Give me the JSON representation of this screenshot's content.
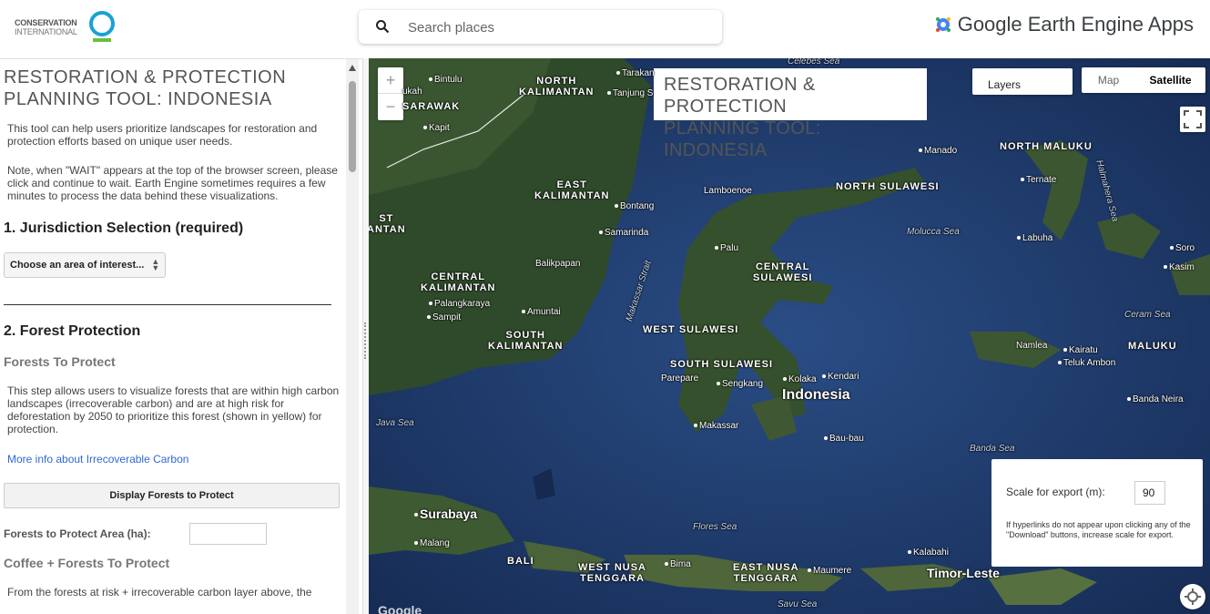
{
  "header": {
    "org_logo_line1": "CONSERVATION",
    "org_logo_line2": "INTERNATIONAL",
    "search_placeholder": "Search places",
    "brand_title": "Google Earth Engine Apps"
  },
  "panel": {
    "title_line1": "RESTORATION & PROTECTION",
    "title_line2": "PLANNING TOOL: INDONESIA",
    "intro": "This tool can help users prioritize landscapes for restoration and protection efforts based on unique user needs.",
    "note": "Note, when \"WAIT\" appears at the top of the browser screen, please click and continue to wait. Earth Engine sometimes requires a few minutes to process the data behind these visualizations.",
    "section1_heading": "1. Jurisdiction Selection (required)",
    "jurisdiction_select": "Choose an area of interest...",
    "section2_heading": "2. Forest Protection",
    "forests_heading": "Forests To Protect",
    "forests_desc": "This step allows users to visualize forests that are within high carbon landscapes (irrecoverable carbon) and are at high risk for deforestation by 2050 to prioritize this forest (shown in yellow) for protection.",
    "more_info_link": "More info about Irrecoverable Carbon",
    "display_button": "Display Forests to Protect",
    "area_label": "Forests to Protect Area (ha):",
    "coffee_heading": "Coffee + Forests To Protect",
    "coffee_desc": "From the forests at risk + irrecoverable carbon layer above, the"
  },
  "map": {
    "zoom_in": "+",
    "zoom_out": "−",
    "title_line1": "RESTORATION & PROTECTION",
    "title_line2": "PLANNING TOOL: INDONESIA",
    "layers_label": "Layers",
    "maptype_map": "Map",
    "maptype_satellite": "Satellite",
    "export_label": "Scale for export (m):",
    "export_value": "90",
    "export_note": "If hyperlinks do not appear upon clicking any of the \"Download\" buttons, increase scale for export.",
    "google_mark": "Google",
    "labels": {
      "celebes_sea": "Celebes Sea",
      "bintulu": "Bintulu",
      "north_kalimantan_1": "NORTH",
      "north_kalimantan_2": "KALIMANTAN",
      "tarakan": "Tarakan",
      "tanjung": "Tanjung S",
      "kuching": "ukah",
      "sarawak": "SARAWAK",
      "kapit": "Kapit",
      "manado": "Manado",
      "north_maluku": "NORTH MALUKU",
      "ternate": "Ternate",
      "halmahera_sea": "Halmahera Sea",
      "east_kalimantan_1": "EAST",
      "east_kalimantan_2": "KALIMANTAN",
      "lamboenoe": "Lamboenoe",
      "north_sulawesi": "NORTH SULAWESI",
      "bontang": "Bontang",
      "west_kal_1": "ST",
      "west_kal_2": "ANTAN",
      "samarinda": "Samarinda",
      "molucca_sea": "Molucca Sea",
      "labuha": "Labuha",
      "soro": "Soro",
      "kasim": "Kasim",
      "palu": "Palu",
      "balikpapan": "Balikpapan",
      "central_sulawesi_1": "CENTRAL",
      "central_sulawesi_2": "SULAWESI",
      "central_kal_1": "CENTRAL",
      "central_kal_2": "KALIMANTAN",
      "makassar_strait": "Makassar Strait",
      "palangkaraya": "Palangkaraya",
      "amuntai": "Amuntai",
      "sampit": "Sampit",
      "ceram_sea": "Ceram Sea",
      "west_sulawesi": "WEST SULAWESI",
      "south_kal_1": "SOUTH",
      "south_kal_2": "KALIMANTAN",
      "namlea": "Namlea",
      "kairatu": "Kairatu",
      "maluku": "MALUKU",
      "south_sulawesi": "SOUTH SULAWESI",
      "teluk_ambon": "Teluk Ambon",
      "parepare": "Parepare",
      "sengkang": "Sengkang",
      "kolaka": "Kolaka",
      "kendari": "Kendari",
      "indonesia": "Indonesia",
      "banda_neira": "Banda Neira",
      "java_sea": "Java Sea",
      "makassar": "Makassar",
      "bau_bau": "Bau-bau",
      "banda_sea": "Banda Sea",
      "surabaya": "Surabaya",
      "malang": "Malang",
      "flores_sea": "Flores Sea",
      "bali": "BALI",
      "west_nt_1": "WEST NUSA",
      "west_nt_2": "TENGGARA",
      "bima": "Bima",
      "east_nt_1": "EAST NUSA",
      "east_nt_2": "TENGGARA",
      "maumere": "Maumere",
      "kalabahi": "Kalabahi",
      "timor_leste": "Timor-Leste",
      "savu_sea": "Savu Sea"
    }
  }
}
